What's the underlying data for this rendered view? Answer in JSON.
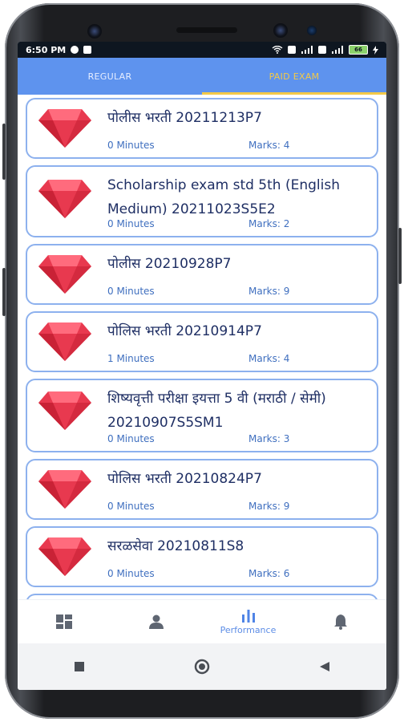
{
  "status_bar": {
    "time": "6:50 PM",
    "battery_label": "66"
  },
  "tabs": [
    {
      "label": "REGULAR",
      "active": false
    },
    {
      "label": "PAID EXAM",
      "active": true
    }
  ],
  "exams": [
    {
      "title": "पोलीस भरती 20211213P7",
      "duration": "0 Minutes",
      "marks": "Marks: 4"
    },
    {
      "title": "Scholarship exam std 5th (English Medium) 20211023S5E2",
      "duration": "0 Minutes",
      "marks": "Marks: 2"
    },
    {
      "title": "पोलीस 20210928P7",
      "duration": "0 Minutes",
      "marks": "Marks: 9"
    },
    {
      "title": "पोलिस भरती 20210914P7",
      "duration": "1 Minutes",
      "marks": "Marks: 4"
    },
    {
      "title": "शिष्यवृत्ती परीक्षा इयत्ता 5 वी (मराठी / सेमी) 20210907S5SM1",
      "duration": "0 Minutes",
      "marks": "Marks: 3"
    },
    {
      "title": "पोलिस भरती 20210824P7",
      "duration": "0 Minutes",
      "marks": "Marks: 9"
    },
    {
      "title": "सरळसेवा 20210811S8",
      "duration": "0 Minutes",
      "marks": "Marks: 6"
    }
  ],
  "bottom_nav": [
    {
      "icon": "dashboard-icon",
      "label": ""
    },
    {
      "icon": "person-icon",
      "label": ""
    },
    {
      "icon": "bar-chart-icon",
      "label": "Performance"
    },
    {
      "icon": "bell-icon",
      "label": ""
    }
  ],
  "colors": {
    "tab_bar": "#5e93ee",
    "active_tab": "#f3c948",
    "card_border": "#8db1ee",
    "title_text": "#1f2f64",
    "meta_text": "#3f6fbf",
    "gem": "#e8394f"
  }
}
